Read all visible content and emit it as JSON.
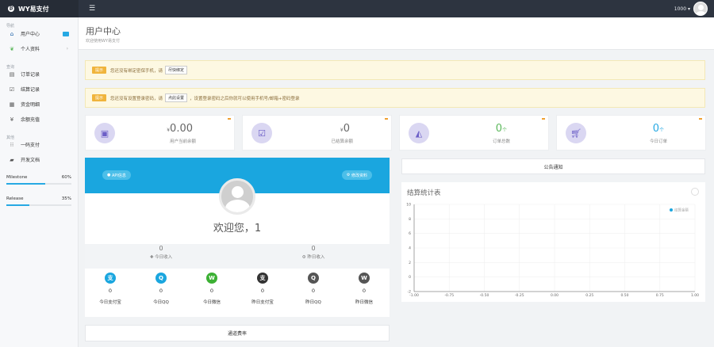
{
  "topbar": {
    "brand": "WY易支付",
    "user": "1000 ▾"
  },
  "sidebar": {
    "section_nav": "导航",
    "section_finance": "查询",
    "section_other": "其他",
    "items": [
      {
        "label": "用户中心",
        "icon": "home-icon"
      },
      {
        "label": "个人资料",
        "icon": "leaf-icon"
      },
      {
        "label": "订单记录",
        "icon": "list-icon"
      },
      {
        "label": "结算记录",
        "icon": "check-square-icon"
      },
      {
        "label": "资金明细",
        "icon": "table-icon"
      },
      {
        "label": "余额充值",
        "icon": "yen-icon"
      },
      {
        "label": "一码支付",
        "icon": "qrcode-icon"
      },
      {
        "label": "开发文档",
        "icon": "book-icon"
      }
    ],
    "progress": [
      {
        "label": "Milestone",
        "value": "60%",
        "fraction": 0.6
      },
      {
        "label": "Release",
        "value": "35%",
        "fraction": 0.35
      }
    ]
  },
  "header": {
    "title": "用户中心",
    "subtitle": "欢迎使用WY易支付"
  },
  "alerts": [
    {
      "tag": "提示",
      "text": "您还没有绑定密保手机，请",
      "button": "尽快绑定",
      "tail": ""
    },
    {
      "tag": "提示",
      "text": "您还没有设置登录密码，请",
      "button": "点此设置",
      "tail": "，设置登录密码之后你就可以使用手机号/邮箱+密码登录"
    }
  ],
  "stats": [
    {
      "prefix": "¥",
      "value": "0.00",
      "unit": "",
      "label": "用户当前余额",
      "icon": "money-icon"
    },
    {
      "prefix": "¥",
      "value": "0",
      "unit": "",
      "label": "已结算余额",
      "icon": "check-square-icon"
    },
    {
      "prefix": "",
      "value": "0",
      "unit": "个",
      "label": "订单总数",
      "icon": "area-chart-icon"
    },
    {
      "prefix": "",
      "value": "0",
      "unit": "个",
      "label": "今日订单",
      "icon": "cart-icon"
    }
  ],
  "profile": {
    "api_button": "API信息",
    "edit_button": "修改资料",
    "welcome": "欢迎您，1",
    "income": [
      {
        "value": "0",
        "label": "今日收入",
        "icon": "plus-icon"
      },
      {
        "value": "0",
        "label": "昨日收入",
        "icon": "gear-icon"
      }
    ],
    "payments": [
      {
        "value": "0",
        "label": "今日支付宝",
        "icon": "alipay-icon",
        "glyph": "支",
        "color": "#1aa6df"
      },
      {
        "value": "0",
        "label": "今日QQ",
        "icon": "qq-icon",
        "glyph": "Q",
        "color": "#1aa6df"
      },
      {
        "value": "0",
        "label": "今日微信",
        "icon": "wechat-icon",
        "glyph": "W",
        "color": "#3cb034"
      },
      {
        "value": "0",
        "label": "昨日支付宝",
        "icon": "alipay-icon",
        "glyph": "支",
        "color": "#333333"
      },
      {
        "value": "0",
        "label": "昨日QQ",
        "icon": "qq-icon",
        "glyph": "Q",
        "color": "#555555"
      },
      {
        "value": "0",
        "label": "昨日微信",
        "icon": "wechat-icon",
        "glyph": "W",
        "color": "#555555"
      }
    ]
  },
  "channel_rates": "通道费率",
  "notice": "公告通知",
  "chart_data": {
    "type": "line",
    "title": "结算统计表",
    "series": [
      {
        "name": "结算金额",
        "color": "#1aa6df",
        "values": []
      }
    ],
    "x": [],
    "xlim": [
      -1.0,
      1.0
    ],
    "ylim": [
      -2,
      10
    ],
    "xticks": [
      "-1.00",
      "-0.75",
      "-0.50",
      "-0.25",
      "0.00",
      "0.25",
      "0.50",
      "0.75",
      "1.00"
    ],
    "yticks": [
      "10",
      "8",
      "6",
      "4",
      "2",
      "0",
      "-2"
    ],
    "grid": true,
    "legend": "top-right"
  },
  "colors": {
    "accent": "#1aa6df",
    "topbar": "#2d3440",
    "warning": "#f0b43c"
  }
}
